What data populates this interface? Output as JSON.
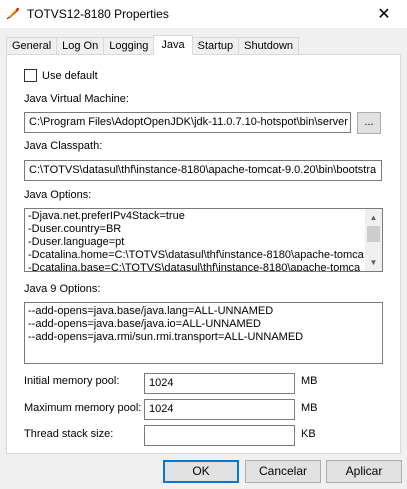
{
  "window": {
    "title": "TOTVS12-8180 Properties",
    "close_glyph": "✕"
  },
  "tabs": [
    {
      "label": "General"
    },
    {
      "label": "Log On"
    },
    {
      "label": "Logging"
    },
    {
      "label": "Java"
    },
    {
      "label": "Startup"
    },
    {
      "label": "Shutdown"
    }
  ],
  "active_tab": "Java",
  "java": {
    "use_default_label": "Use default",
    "use_default_checked": false,
    "jvm_label": "Java Virtual Machine:",
    "jvm_value": "C:\\Program Files\\AdoptOpenJDK\\jdk-11.0.7.10-hotspot\\bin\\server",
    "browse_label": "...",
    "classpath_label": "Java Classpath:",
    "classpath_value": "C:\\TOTVS\\datasul\\thf\\instance-8180\\apache-tomcat-9.0.20\\bin\\bootstra",
    "options_label": "Java Options:",
    "options_lines": [
      "-Djava.net.preferIPv4Stack=true",
      "-Duser.country=BR",
      "-Duser.language=pt",
      "-Dcatalina.home=C:\\TOTVS\\datasul\\thf\\instance-8180\\apache-tomca",
      "-Dcatalina.base=C:\\TOTVS\\datasul\\thf\\instance-8180\\apache-tomca"
    ],
    "java9_label": "Java 9 Options:",
    "java9_lines": [
      "--add-opens=java.base/java.lang=ALL-UNNAMED",
      "--add-opens=java.base/java.io=ALL-UNNAMED",
      "--add-opens=java.rmi/sun.rmi.transport=ALL-UNNAMED"
    ],
    "initial_pool_label": "Initial memory pool:",
    "initial_pool_value": "1024",
    "initial_pool_unit": "MB",
    "max_pool_label": "Maximum memory pool:",
    "max_pool_value": "1024",
    "max_pool_unit": "MB",
    "stack_label": "Thread stack size:",
    "stack_value": "",
    "stack_unit": "KB"
  },
  "buttons": {
    "ok": "OK",
    "cancel": "Cancelar",
    "apply": "Aplicar"
  },
  "colors": {
    "accent": "#0078d7",
    "dialog_bg": "#f0f0f0"
  }
}
